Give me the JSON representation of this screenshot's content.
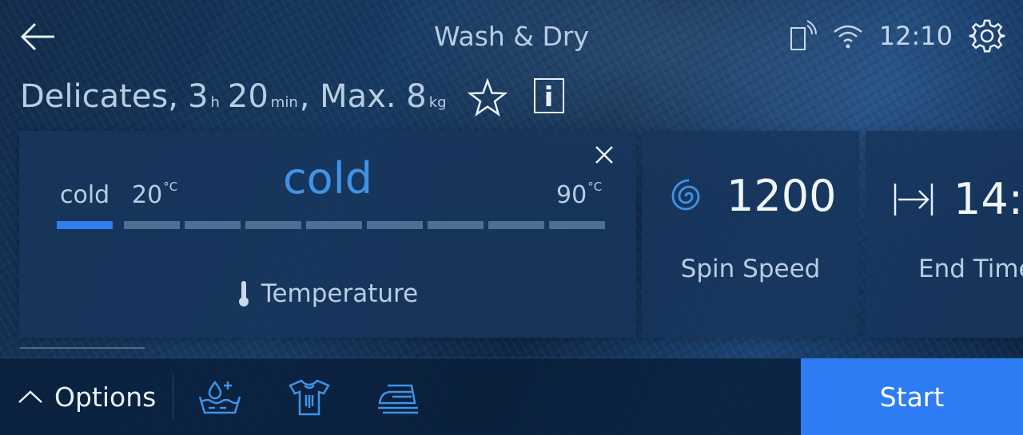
{
  "header": {
    "title": "Wash & Dry",
    "time": "12:10",
    "icons": [
      "back-arrow-icon",
      "remote-control-icon",
      "wifi-icon",
      "settings-gear-icon"
    ]
  },
  "program": {
    "name": "Delicates,",
    "hours": "3",
    "hours_unit": "h",
    "minutes": "20",
    "minutes_unit": "min",
    "max_label": ", Max. 8",
    "max_unit": "kg",
    "icons": [
      "favorite-star-icon",
      "info-icon"
    ]
  },
  "temperature": {
    "selected": "cold",
    "scale_min_label": "cold",
    "scale_first_label": "20",
    "scale_last_label": "90",
    "unit": "°C",
    "level_count": 9,
    "selected_index": 0,
    "caption": "Temperature",
    "icons": [
      "thermometer-icon",
      "close-icon"
    ]
  },
  "spin": {
    "value": "1200",
    "caption": "Spin Speed",
    "icon": "spin-swirl-icon"
  },
  "end_time": {
    "value": "14:",
    "caption": "End Time",
    "icon": "end-time-arrow-icon"
  },
  "bottom": {
    "options_label": "Options",
    "start_label": "Start",
    "option_icons": [
      "prewash-water-plus-icon",
      "hand-wash-shirt-icon",
      "iron-icon"
    ],
    "icons": [
      "chevron-up-icon"
    ]
  },
  "colors": {
    "accent": "#2e7cf3",
    "selected_text": "#3f93e6",
    "segment_inactive": "#4e6f93"
  }
}
